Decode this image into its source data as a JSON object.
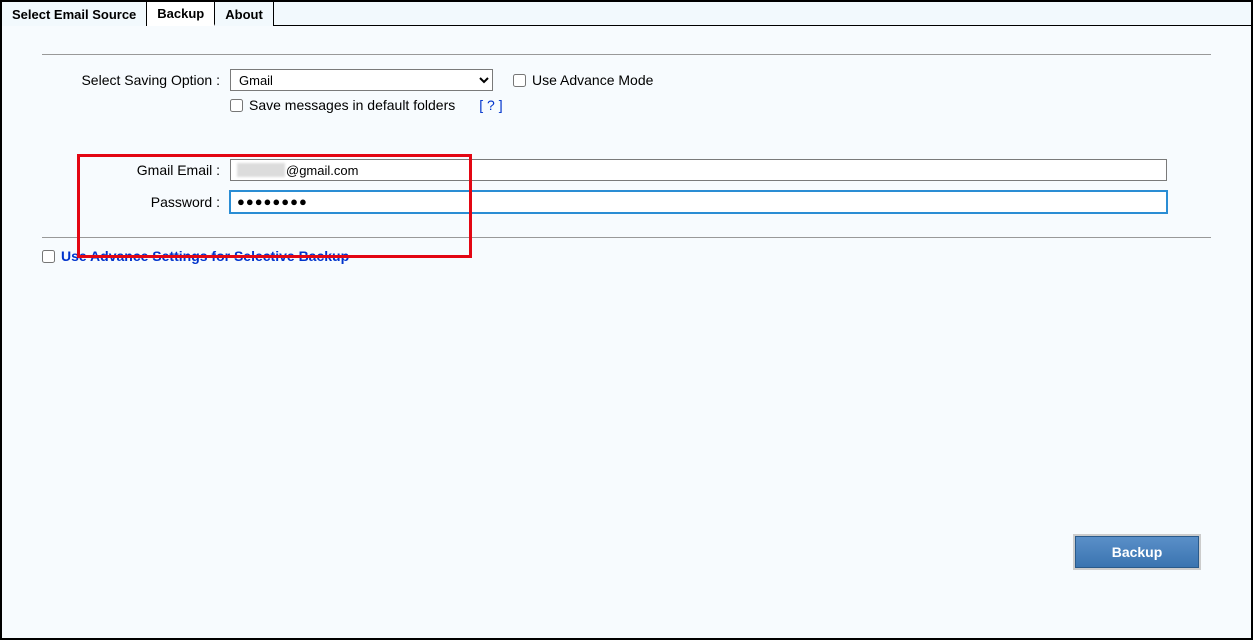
{
  "tabs": {
    "source": "Select Email Source",
    "backup": "Backup",
    "about": "About"
  },
  "saving": {
    "label": "Select Saving Option  :",
    "selected": "Gmail",
    "advance_mode": "Use Advance Mode",
    "save_default": "Save messages in default folders",
    "help": "[ ? ]"
  },
  "cred": {
    "email_label": "Gmail Email  :",
    "email_suffix": "@gmail.com",
    "password_label": "Password  :",
    "password_value": "●●●●●●●●"
  },
  "advance_settings": "Use Advance Settings for Selective Backup",
  "backup_button": "Backup"
}
